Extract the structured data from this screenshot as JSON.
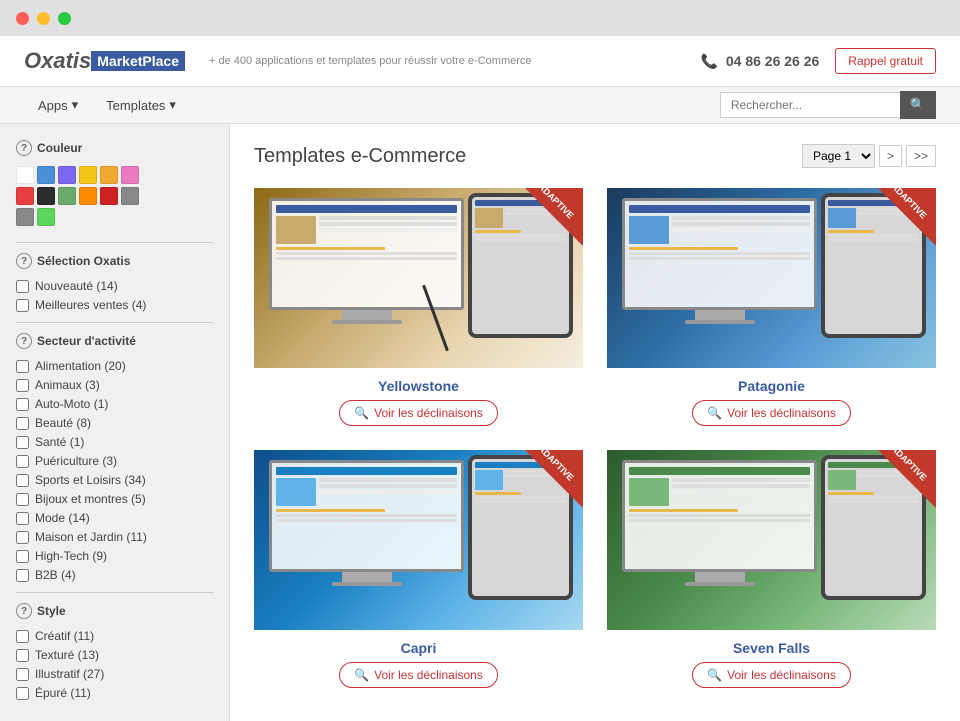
{
  "titlebar": {
    "btn_red": "close",
    "btn_yellow": "minimize",
    "btn_green": "maximize"
  },
  "header": {
    "logo_oxatis": "Oxatis",
    "logo_marketplace": "MarketPlace",
    "tagline": "+ de 400 applications et templates pour réussir votre e-Commerce",
    "phone_icon": "📞",
    "phone": "04 86 26 26 26",
    "rappel_label": "Rappel gratuit"
  },
  "nav": {
    "apps_label": "Apps",
    "templates_label": "Templates",
    "search_placeholder": "Rechercher...",
    "search_btn_icon": "🔍"
  },
  "sidebar": {
    "couleur_title": "Couleur",
    "colors": [
      {
        "hex": "#ffffff",
        "name": "white"
      },
      {
        "hex": "#4a90d9",
        "name": "blue"
      },
      {
        "hex": "#7b68ee",
        "name": "purple"
      },
      {
        "hex": "#f5c518",
        "name": "yellow"
      },
      {
        "hex": "#f0a830",
        "name": "orange"
      },
      {
        "hex": "#e87cbe",
        "name": "pink"
      },
      {
        "hex": "#e84040",
        "name": "red"
      },
      {
        "hex": "#2c2c2c",
        "name": "black"
      },
      {
        "hex": "#6aaa6a",
        "name": "green"
      },
      {
        "hex": "#ff8c00",
        "name": "dark-orange"
      },
      {
        "hex": "#cc2222",
        "name": "dark-red"
      },
      {
        "hex": "#888888",
        "name": "gray"
      },
      {
        "hex": "#5cd65c",
        "name": "light-green"
      }
    ],
    "selection_title": "Sélection Oxatis",
    "selection_items": [
      {
        "label": "Nouveauté (14)",
        "checked": false
      },
      {
        "label": "Meilleures ventes (4)",
        "checked": false
      }
    ],
    "secteur_title": "Secteur d'activité",
    "secteur_items": [
      {
        "label": "Alimentation (20)",
        "checked": false
      },
      {
        "label": "Animaux (3)",
        "checked": false
      },
      {
        "label": "Auto-Moto (1)",
        "checked": false
      },
      {
        "label": "Beauté (8)",
        "checked": false
      },
      {
        "label": "Santé (1)",
        "checked": false
      },
      {
        "label": "Puériculture (3)",
        "checked": false
      },
      {
        "label": "Sports et Loisirs (34)",
        "checked": false
      },
      {
        "label": "Bijoux et montres (5)",
        "checked": false
      },
      {
        "label": "Mode (14)",
        "checked": false
      },
      {
        "label": "Maison et Jardin (11)",
        "checked": false
      },
      {
        "label": "High-Tech (9)",
        "checked": false
      },
      {
        "label": "B2B (4)",
        "checked": false
      }
    ],
    "style_title": "Style",
    "style_items": [
      {
        "label": "Créatif (11)",
        "checked": false
      },
      {
        "label": "Texturé (13)",
        "checked": false
      },
      {
        "label": "Illustratif (27)",
        "checked": false
      },
      {
        "label": "Épuré (11)",
        "checked": false
      }
    ]
  },
  "content": {
    "page_title": "Templates e-Commerce",
    "pagination": {
      "page_select_label": "Page 1",
      "next_label": ">",
      "last_label": ">>"
    },
    "templates": [
      {
        "name": "Yellowstone",
        "voir_label": "Voir les déclinaisons",
        "badge": "ADAPTIVE",
        "bg_class": "bg-yellowstone"
      },
      {
        "name": "Patagonie",
        "voir_label": "Voir les déclinaisons",
        "badge": "ADAPTIVE",
        "bg_class": "bg-patagonie"
      },
      {
        "name": "Capri",
        "voir_label": "Voir les déclinaisons",
        "badge": "ADAPTIVE",
        "bg_class": "bg-capri"
      },
      {
        "name": "Seven Falls",
        "voir_label": "Voir les déclinaisons",
        "badge": "ADAPTIVE",
        "bg_class": "bg-sevenfalls"
      }
    ]
  }
}
